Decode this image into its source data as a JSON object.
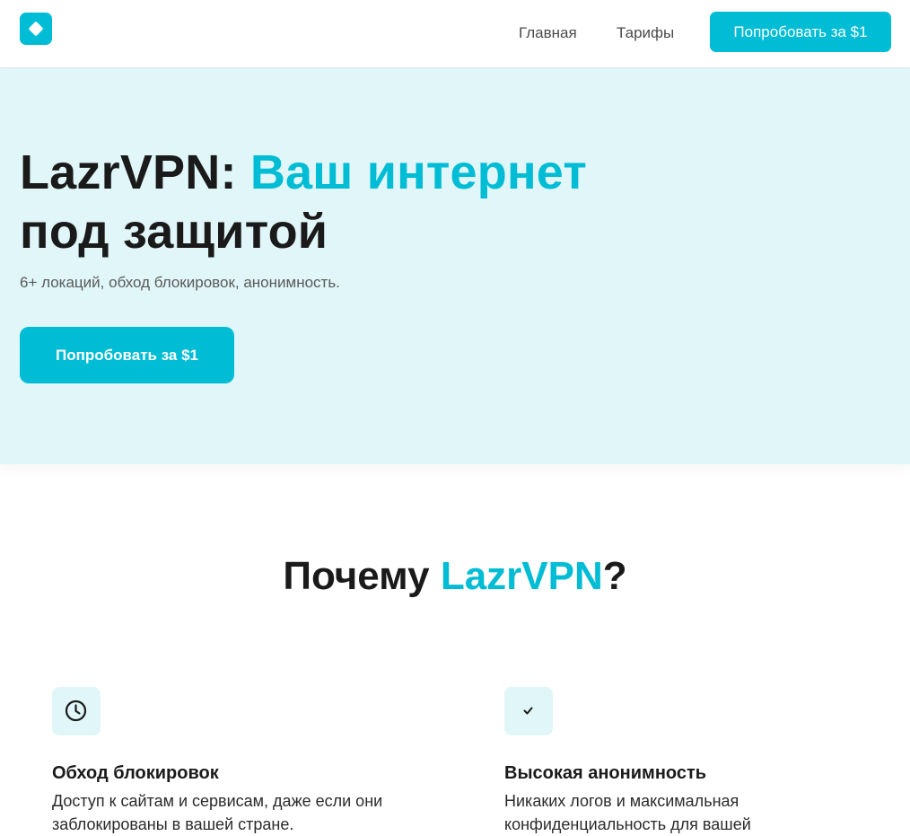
{
  "header": {
    "logo_icon": "diamond-logo-icon",
    "nav": {
      "home": "Главная",
      "pricing": "Тарифы"
    },
    "cta_label": "Попробовать за $1"
  },
  "hero": {
    "title_brand": "LazrVPN:",
    "title_accent": "Ваш интернет",
    "title_rest": "под защитой",
    "subtitle": "6+ локаций, обход блокировок, анонимность.",
    "cta_label": "Попробовать за $1"
  },
  "why": {
    "title_prefix": "Почему",
    "title_accent": "LazrVPN",
    "title_suffix": "?"
  },
  "features": [
    {
      "icon": "clock-icon",
      "title": "Обход блокировок",
      "text": "Доступ к сайтам и сервисам, даже если они заблокированы в вашей стране."
    },
    {
      "icon": "check-icon",
      "title": "Высокая анонимность",
      "text": "Никаких логов и максимальная конфиденциальность для вашей"
    }
  ],
  "colors": {
    "accent": "#00bcd4",
    "hero_bg": "#e0f6f8",
    "text": "#1a1a1a"
  }
}
